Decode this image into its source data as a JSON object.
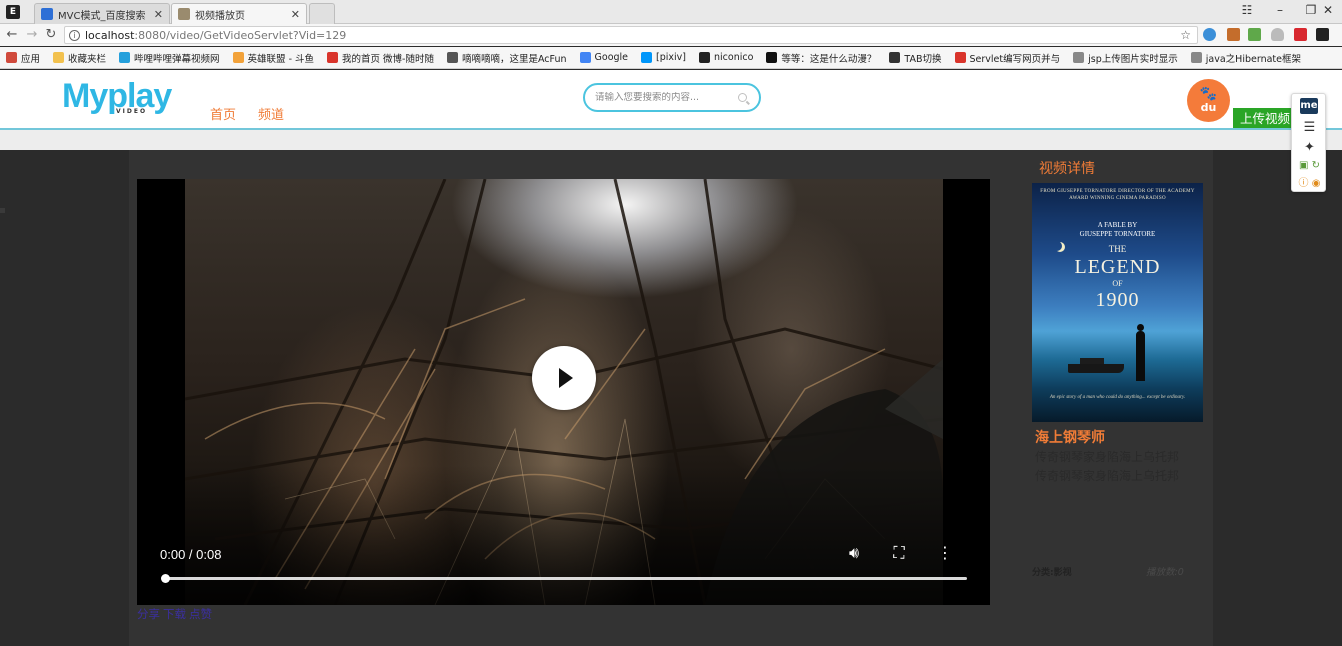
{
  "browser": {
    "tabs": [
      {
        "title": "MVC模式_百度搜索",
        "favicon_color": "#2d6fd6"
      },
      {
        "title": "视频播放页",
        "favicon_color": "#9a8b6e"
      }
    ],
    "url_host": "localhost",
    "url_path": ":8080/video/GetVideoServlet?Vid=129",
    "bookmarks": [
      {
        "label": "应用",
        "icon_color": "#d04a3c"
      },
      {
        "label": "收藏夹栏",
        "icon_color": "#f2c14e"
      },
      {
        "label": "哔哩哔哩弹幕视频网",
        "icon_color": "#25a0dc"
      },
      {
        "label": "英雄联盟 - 斗鱼",
        "icon_color": "#f2a23a"
      },
      {
        "label": "我的首页 微博-随时随",
        "icon_color": "#d9342b"
      },
      {
        "label": "嘀嘀嘀嘀，这里是AcFun",
        "icon_color": "#555555"
      },
      {
        "label": "Google",
        "icon_color": "#4285f4"
      },
      {
        "label": "[pixiv]",
        "icon_color": "#0096fa"
      },
      {
        "label": "niconico",
        "icon_color": "#222222"
      },
      {
        "label": "等等：这是什么动漫？",
        "icon_color": "#111111"
      },
      {
        "label": "TAB切换",
        "icon_color": "#333333"
      },
      {
        "label": "Servlet编写网页并与",
        "icon_color": "#d9342b"
      },
      {
        "label": "jsp上传图片实时显示",
        "icon_color": "#888888"
      },
      {
        "label": "java之Hibernate框架",
        "icon_color": "#888888"
      }
    ]
  },
  "site": {
    "logo_text": "Myplay",
    "logo_sub": "VIDEO",
    "nav": [
      "首页",
      "频道"
    ],
    "search_placeholder": "请输入您要搜索的内容...",
    "avatar_text": "du",
    "upload_label": "上传视频",
    "accent_color": "#f07c37",
    "brand_color": "#2fb7e4"
  },
  "ext_popup": {
    "badge": "me"
  },
  "player": {
    "time": "0:00 / 0:08",
    "progress": 0
  },
  "actions": [
    "分享",
    "下载",
    "点赞"
  ],
  "detail": {
    "section_title": "视频详情",
    "poster": {
      "top_credit": "FROM GIUSEPPE TORNATORE DIRECTOR OF THE ACADEMY AWARD WINNING CINEMA PARADISO",
      "fable_line1": "A FABLE BY",
      "fable_line2": "GIUSEPPE TORNATORE",
      "title_the": "THE",
      "title_legend": "LEGEND",
      "title_of": "OF",
      "title_year": "1900",
      "tagline": "An epic story of a man who could do anything... except be ordinary."
    },
    "movie_title": "海上钢琴师",
    "desc": [
      "传奇钢琴家身陷海上乌托邦",
      "传奇钢琴家身陷海上乌托邦"
    ],
    "category": "分类:影视",
    "plays": "播放数:0"
  }
}
